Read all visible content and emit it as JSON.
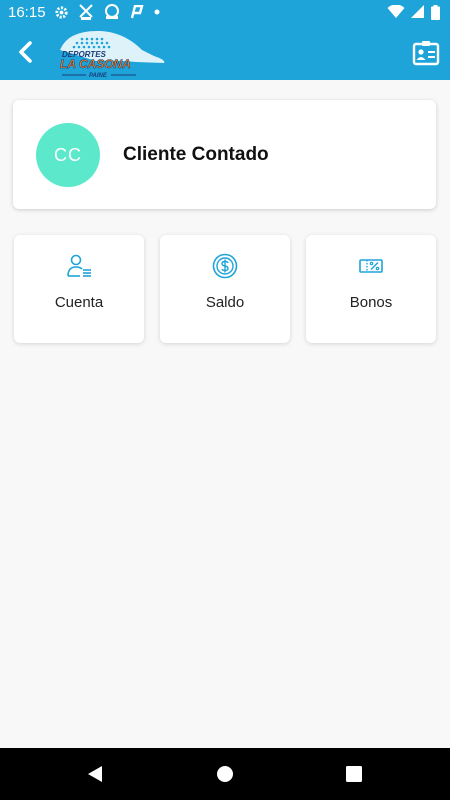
{
  "status_bar": {
    "time": "16:15",
    "icons": [
      "gear-icon",
      "padel-logo-icon",
      "badge-icon",
      "p-app-icon",
      "dot-icon",
      "wifi-icon",
      "signal-icon",
      "battery-icon"
    ]
  },
  "app_bar": {
    "background": "#1ea4d9",
    "logo": {
      "line1": "DEPORTES",
      "line2": "LA CASONA",
      "line3": "PAINE"
    },
    "back_icon": "chevron-left-icon",
    "action_icon": "contact-card-icon"
  },
  "profile": {
    "initials": "CC",
    "name": "Cliente Contado",
    "avatar_color": "#5ce8cb"
  },
  "tiles": [
    {
      "label": "Cuenta",
      "icon": "user-list-icon"
    },
    {
      "label": "Saldo",
      "icon": "dollar-coin-icon"
    },
    {
      "label": "Bonos",
      "icon": "percent-ticket-icon"
    }
  ],
  "accent_color": "#1ea4d9"
}
